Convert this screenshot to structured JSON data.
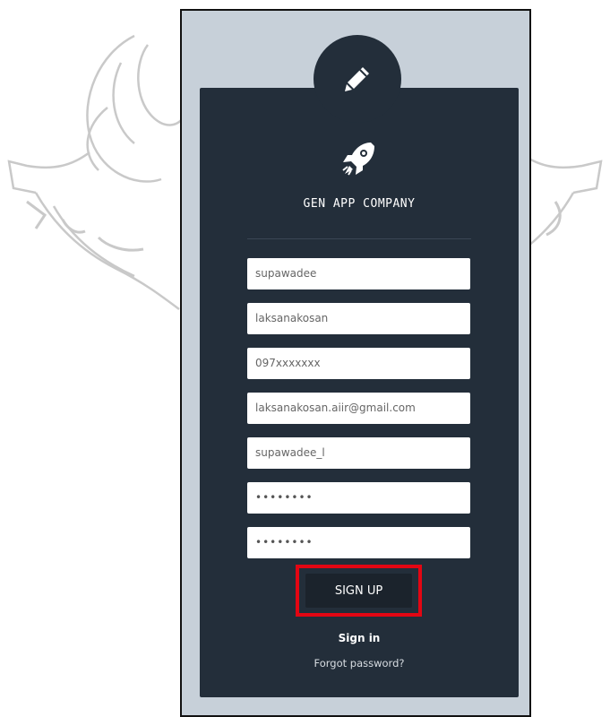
{
  "form": {
    "company_name": "GEN APP COMPANY",
    "fields": [
      {
        "name": "first-name-field",
        "value": "supawadee"
      },
      {
        "name": "last-name-field",
        "value": "laksanakosan"
      },
      {
        "name": "phone-field",
        "value": "097xxxxxxx"
      },
      {
        "name": "email-field",
        "value": "laksanakosan.aiir@gmail.com"
      },
      {
        "name": "username-field",
        "value": "supawadee_l"
      },
      {
        "name": "password-field",
        "value": "••••••••"
      },
      {
        "name": "confirm-password-field",
        "value": "••••••••"
      }
    ],
    "signup_label": "SIGN UP",
    "signin_label": "Sign in",
    "forgot_label": "Forgot password?"
  },
  "icons": {
    "avatar": "pencil-icon",
    "logo": "rocket-icon"
  },
  "colors": {
    "card_bg": "#232e3a",
    "page_bg": "#c7d0d9",
    "highlight": "#e30613"
  }
}
